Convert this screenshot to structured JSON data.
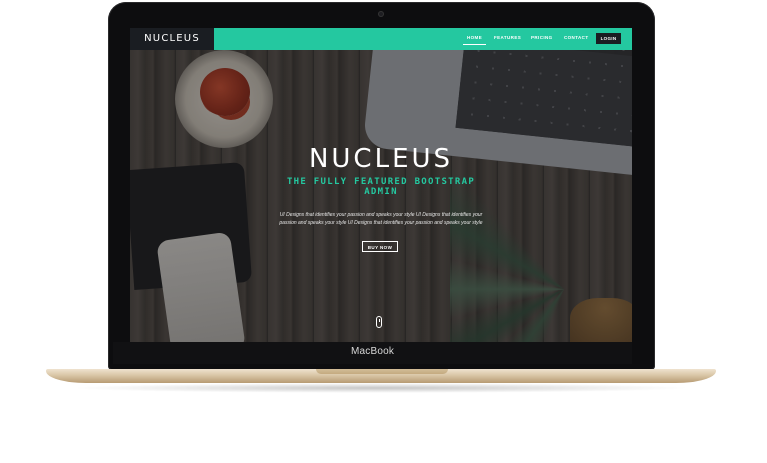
{
  "device": {
    "label": "MacBook"
  },
  "navbar": {
    "brand": "NUCLEUS",
    "items": [
      {
        "label": "HOME",
        "active": true
      },
      {
        "label": "FEATURES",
        "active": false
      },
      {
        "label": "PRICING",
        "active": false
      },
      {
        "label": "CONTACT",
        "active": false
      }
    ],
    "login_label": "LOGIN"
  },
  "hero": {
    "title": "NUCLEUS",
    "subtitle": "THE FULLY FEATURED BOOTSTRAP ADMIN",
    "description": "UI Designs that identifies your passion and speaks your style UI Designs that identifies your passion and speaks your style UI Designs that identifies your passion and speaks your style",
    "button_label": "BUY NOW"
  },
  "colors": {
    "accent": "#24c8a0",
    "dark": "#1a1d22",
    "laptop_gold": "#d9c6a6"
  }
}
